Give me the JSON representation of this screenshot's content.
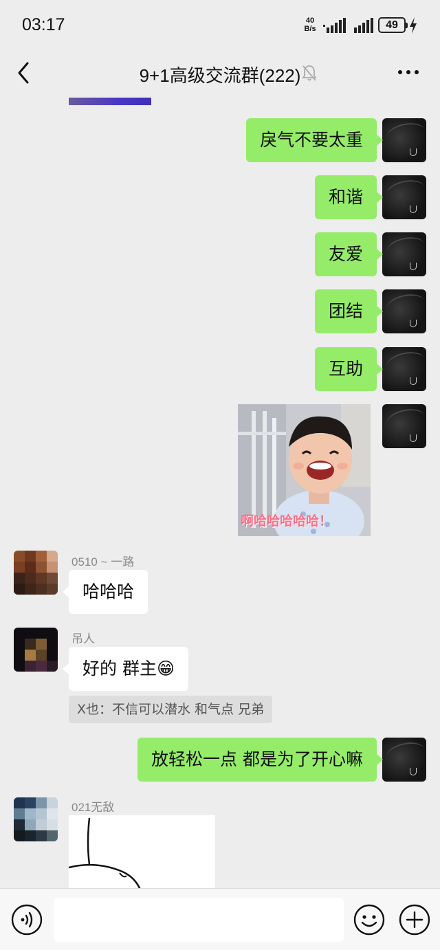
{
  "status_bar": {
    "time": "03:17",
    "net_speed_value": "40",
    "net_speed_unit": "B/s",
    "battery": "49"
  },
  "header": {
    "title": "9+1高级交流群(222)"
  },
  "messages_self": [
    {
      "text": "戾气不要太重"
    },
    {
      "text": "和谐"
    },
    {
      "text": "友爱"
    },
    {
      "text": "团结"
    },
    {
      "text": "互助"
    },
    {
      "sticker_caption": "啊哈哈哈哈哈！"
    },
    {
      "text": "放轻松一点 都是为了开心嘛"
    }
  ],
  "messages_other": [
    {
      "sender": "0510 ~ 一路",
      "text": "哈哈哈"
    },
    {
      "sender": "吊人",
      "text": "好的 群主😁",
      "quote": "X也：不信可以潜水 和气点 兄弟"
    },
    {
      "sender": "021无敌"
    }
  ],
  "input": {
    "placeholder": ""
  },
  "colors": {
    "bubble_self": "#95ec69",
    "bubble_other": "#ffffff",
    "background": "#ededed"
  },
  "icons": [
    "signal-icon",
    "battery-icon",
    "charge-icon",
    "back-icon",
    "mute-icon",
    "more-icon",
    "voice-icon",
    "emoji-icon",
    "add-icon"
  ]
}
